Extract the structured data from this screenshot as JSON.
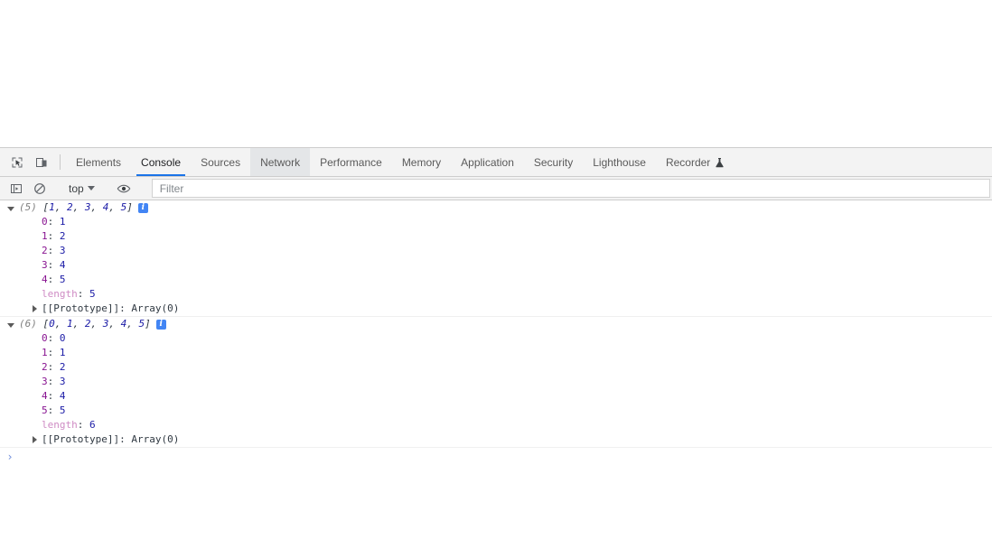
{
  "devtools": {
    "toolbar_icons": [
      {
        "name": "inspect-element-icon",
        "title": "Inspect element"
      },
      {
        "name": "device-toolbar-icon",
        "title": "Toggle device toolbar"
      }
    ],
    "tabs": [
      {
        "label": "Elements",
        "state": "normal"
      },
      {
        "label": "Console",
        "state": "active"
      },
      {
        "label": "Sources",
        "state": "normal"
      },
      {
        "label": "Network",
        "state": "hovered"
      },
      {
        "label": "Performance",
        "state": "normal"
      },
      {
        "label": "Memory",
        "state": "normal"
      },
      {
        "label": "Application",
        "state": "normal"
      },
      {
        "label": "Security",
        "state": "normal"
      },
      {
        "label": "Lighthouse",
        "state": "normal"
      },
      {
        "label": "Recorder",
        "state": "normal",
        "icon": "experiment-flask-icon"
      }
    ]
  },
  "console_toolbar": {
    "sidebar_toggle_icon": "console-sidebar-icon",
    "clear_icon": "clear-console-icon",
    "context_selector": "top",
    "eye_icon": "live-expression-eye-icon",
    "filter_placeholder": "Filter",
    "filter_value": ""
  },
  "console_logs": [
    {
      "expanded": true,
      "count": "(5)",
      "preview_open": "[",
      "preview_items": [
        "1",
        "2",
        "3",
        "4",
        "5"
      ],
      "preview_close": "]",
      "badge": "info-badge",
      "properties": [
        {
          "key": "0",
          "value": "1"
        },
        {
          "key": "1",
          "value": "2"
        },
        {
          "key": "2",
          "value": "3"
        },
        {
          "key": "3",
          "value": "4"
        },
        {
          "key": "4",
          "value": "5"
        }
      ],
      "length_key": "length",
      "length_value": "5",
      "prototype": "[[Prototype]]: Array(0)"
    },
    {
      "expanded": true,
      "count": "(6)",
      "preview_open": "[",
      "preview_items": [
        "0",
        "1",
        "2",
        "3",
        "4",
        "5"
      ],
      "preview_close": "]",
      "badge": "info-badge",
      "properties": [
        {
          "key": "0",
          "value": "0"
        },
        {
          "key": "1",
          "value": "1"
        },
        {
          "key": "2",
          "value": "2"
        },
        {
          "key": "3",
          "value": "3"
        },
        {
          "key": "4",
          "value": "4"
        },
        {
          "key": "5",
          "value": "5"
        }
      ],
      "length_key": "length",
      "length_value": "6",
      "prototype": "[[Prototype]]: Array(0)"
    }
  ],
  "prompt": {
    "chevron": "›",
    "value": "",
    "placeholder": ""
  },
  "colors": {
    "accent": "#1a73e8",
    "badge": "#4285f4",
    "key": "#881391",
    "length_key": "#cf8bc4",
    "number": "#1a1aa6",
    "toolbar_bg": "#f3f3f3"
  }
}
